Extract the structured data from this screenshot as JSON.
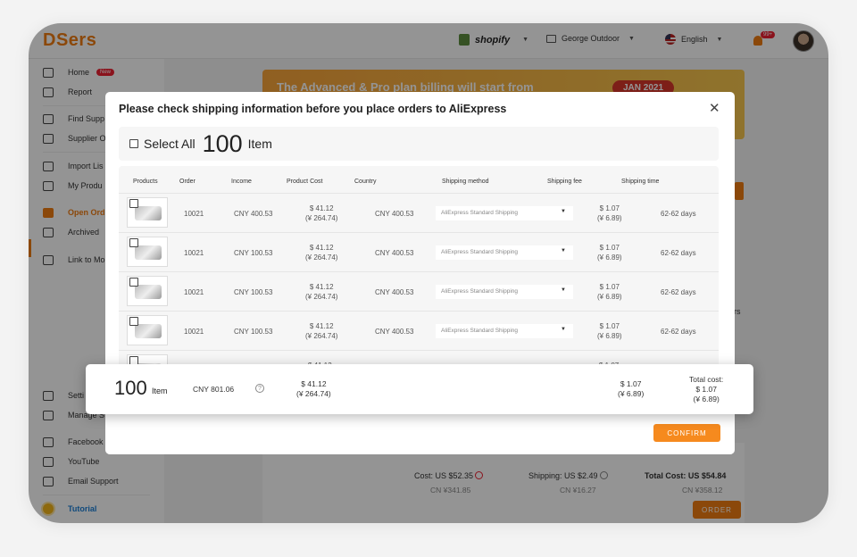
{
  "app": {
    "logo": "DSers",
    "platform": "shopify",
    "store": "George Outdoor",
    "language": "English",
    "notification_count": "99+"
  },
  "sidebar": {
    "items": [
      {
        "label": "Home",
        "badge": "New",
        "icon": "home-icon"
      },
      {
        "label": "Report",
        "icon": "report-icon"
      },
      {
        "label": "Find Supp",
        "icon": "search-icon"
      },
      {
        "label": "Supplier O",
        "icon": "supplier-icon"
      },
      {
        "label": "Import Lis",
        "icon": "import-list-icon"
      },
      {
        "label": "My Produ",
        "icon": "products-icon"
      },
      {
        "label": "Open Ord",
        "icon": "orders-icon"
      },
      {
        "label": "Archived",
        "icon": "archive-icon"
      },
      {
        "label": "Link to Mo",
        "icon": "link-icon"
      },
      {
        "label": "Setti",
        "icon": "gear-icon"
      },
      {
        "label": "Manage S",
        "icon": "sliders-icon"
      },
      {
        "label": "Facebook",
        "icon": "facebook-icon"
      },
      {
        "label": "YouTube",
        "icon": "youtube-icon"
      },
      {
        "label": "Email Support",
        "icon": "mail-icon"
      },
      {
        "label": "Tutorial",
        "icon": "lightbulb-icon"
      }
    ]
  },
  "background": {
    "banner_text": "The Advanced & Pro plan billing will start from",
    "banner_pill": "JAN 2021",
    "partial_right_1": "rs",
    "cost_label": "Cost: US $52.35",
    "cost_cny": "CN ¥341.85",
    "shipping_label": "Shipping: US $2.49",
    "shipping_cny": "CN ¥16.27",
    "total_label": "Total Cost: US $54.84",
    "total_cny": "CN ¥358.12",
    "order_button": "ORDER"
  },
  "modal": {
    "title": "Please check shipping information before you place orders to AliExpress",
    "select_all_label": "Select All",
    "select_all_count": "100",
    "select_all_unit": "Item",
    "columns": [
      "Products",
      "Order",
      "Income",
      "Product Cost",
      "Country",
      "Shipping method",
      "Shipping fee",
      "Shipping time"
    ],
    "rows": [
      {
        "order": "10021",
        "income": "CNY 400.53",
        "cost_usd": "$ 41.12",
        "cost_cny": "(¥ 264.74)",
        "country": "CNY 400.53",
        "method": "AliExpress Standard Shipping",
        "fee_usd": "$ 1.07",
        "fee_cny": "(¥ 6.89)",
        "time": "62-62 days"
      },
      {
        "order": "10021",
        "income": "CNY 100.53",
        "cost_usd": "$ 41.12",
        "cost_cny": "(¥ 264.74)",
        "country": "CNY 400.53",
        "method": "AliExpress Standard Shipping",
        "fee_usd": "$ 1.07",
        "fee_cny": "(¥ 6.89)",
        "time": "62-62 days"
      },
      {
        "order": "10021",
        "income": "CNY 100.53",
        "cost_usd": "$ 41.12",
        "cost_cny": "(¥ 264.74)",
        "country": "CNY 400.53",
        "method": "AliExpress Standard Shipping",
        "fee_usd": "$ 1.07",
        "fee_cny": "(¥ 6.89)",
        "time": "62-62 days"
      },
      {
        "order": "10021",
        "income": "CNY 100.53",
        "cost_usd": "$ 41.12",
        "cost_cny": "(¥ 264.74)",
        "country": "CNY 400.53",
        "method": "AliExpress Standard Shipping",
        "fee_usd": "$ 1.07",
        "fee_cny": "(¥ 6.89)",
        "time": "62-62 days"
      },
      {
        "cost_usd": "$ 41.12",
        "fee_usd": "$ 1.07"
      }
    ],
    "summary": {
      "count": "100",
      "unit": "Item",
      "income": "CNY 801.06",
      "cost_usd": "$ 41.12",
      "cost_cny": "(¥ 264.74)",
      "fee_usd": "$ 1.07",
      "fee_cny": "(¥ 6.89)",
      "total_label": "Total cost:",
      "total_usd": "$ 1.07",
      "total_cny": "(¥ 6.89)"
    },
    "confirm_label": "CONFIRM"
  },
  "colors": {
    "accent": "#f07c12",
    "tutorial": "#1a7fd6"
  }
}
